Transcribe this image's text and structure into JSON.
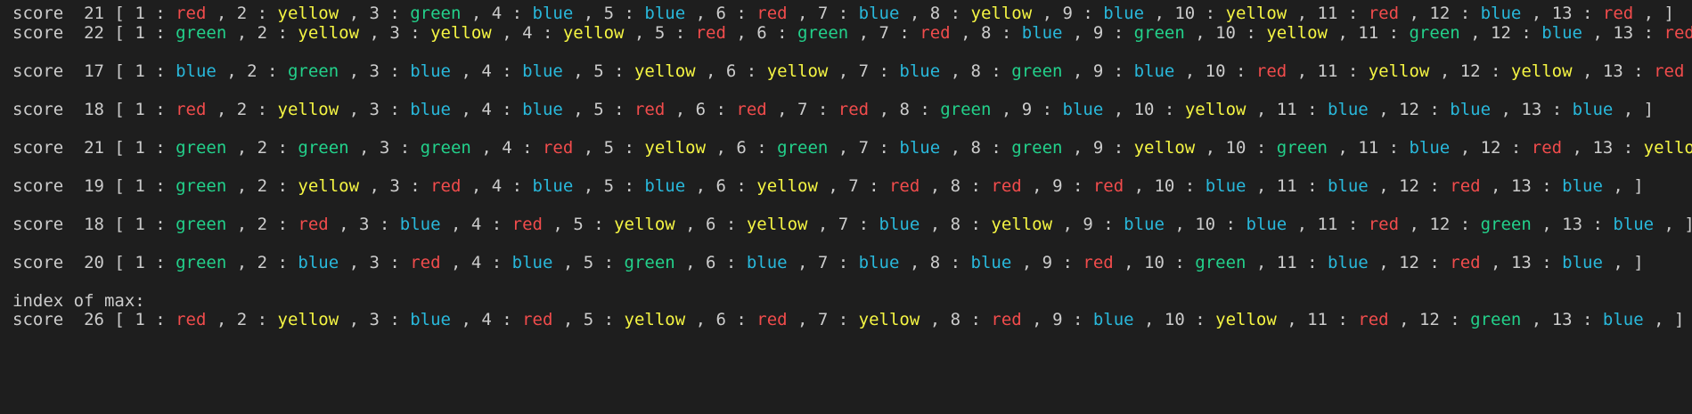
{
  "colors": {
    "background": "#1e1e1e",
    "text": "#cccccc",
    "red": "#f14c4c",
    "yellow": "#f5f543",
    "green": "#23d18b",
    "blue": "#29b8db"
  },
  "score_label": "score",
  "rows": [
    {
      "score": "21",
      "items": [
        "red",
        "yellow",
        "green",
        "blue",
        "blue",
        "red",
        "blue",
        "yellow",
        "blue",
        "yellow",
        "red",
        "blue",
        "red"
      ]
    },
    {
      "score": "22",
      "items": [
        "green",
        "yellow",
        "yellow",
        "yellow",
        "red",
        "green",
        "red",
        "blue",
        "green",
        "yellow",
        "green",
        "blue",
        "red"
      ]
    },
    {
      "score": "17",
      "items": [
        "blue",
        "green",
        "blue",
        "blue",
        "yellow",
        "yellow",
        "blue",
        "green",
        "blue",
        "red",
        "yellow",
        "yellow",
        "red"
      ]
    },
    {
      "score": "18",
      "items": [
        "red",
        "yellow",
        "blue",
        "blue",
        "red",
        "red",
        "red",
        "green",
        "blue",
        "yellow",
        "blue",
        "blue",
        "blue"
      ]
    },
    {
      "score": "21",
      "items": [
        "green",
        "green",
        "green",
        "red",
        "yellow",
        "green",
        "blue",
        "green",
        "yellow",
        "green",
        "blue",
        "red",
        "yellow"
      ]
    },
    {
      "score": "19",
      "items": [
        "green",
        "yellow",
        "red",
        "blue",
        "blue",
        "yellow",
        "red",
        "red",
        "red",
        "blue",
        "blue",
        "red",
        "blue"
      ]
    },
    {
      "score": "18",
      "items": [
        "green",
        "red",
        "blue",
        "red",
        "yellow",
        "yellow",
        "blue",
        "yellow",
        "blue",
        "blue",
        "red",
        "green",
        "blue"
      ]
    },
    {
      "score": "20",
      "items": [
        "green",
        "blue",
        "red",
        "blue",
        "green",
        "blue",
        "blue",
        "blue",
        "red",
        "green",
        "blue",
        "red",
        "blue"
      ]
    }
  ],
  "max_heading": "index of max:",
  "max_row": {
    "score": "26",
    "items": [
      "red",
      "yellow",
      "blue",
      "red",
      "yellow",
      "red",
      "yellow",
      "red",
      "blue",
      "yellow",
      "red",
      "green",
      "blue"
    ]
  }
}
